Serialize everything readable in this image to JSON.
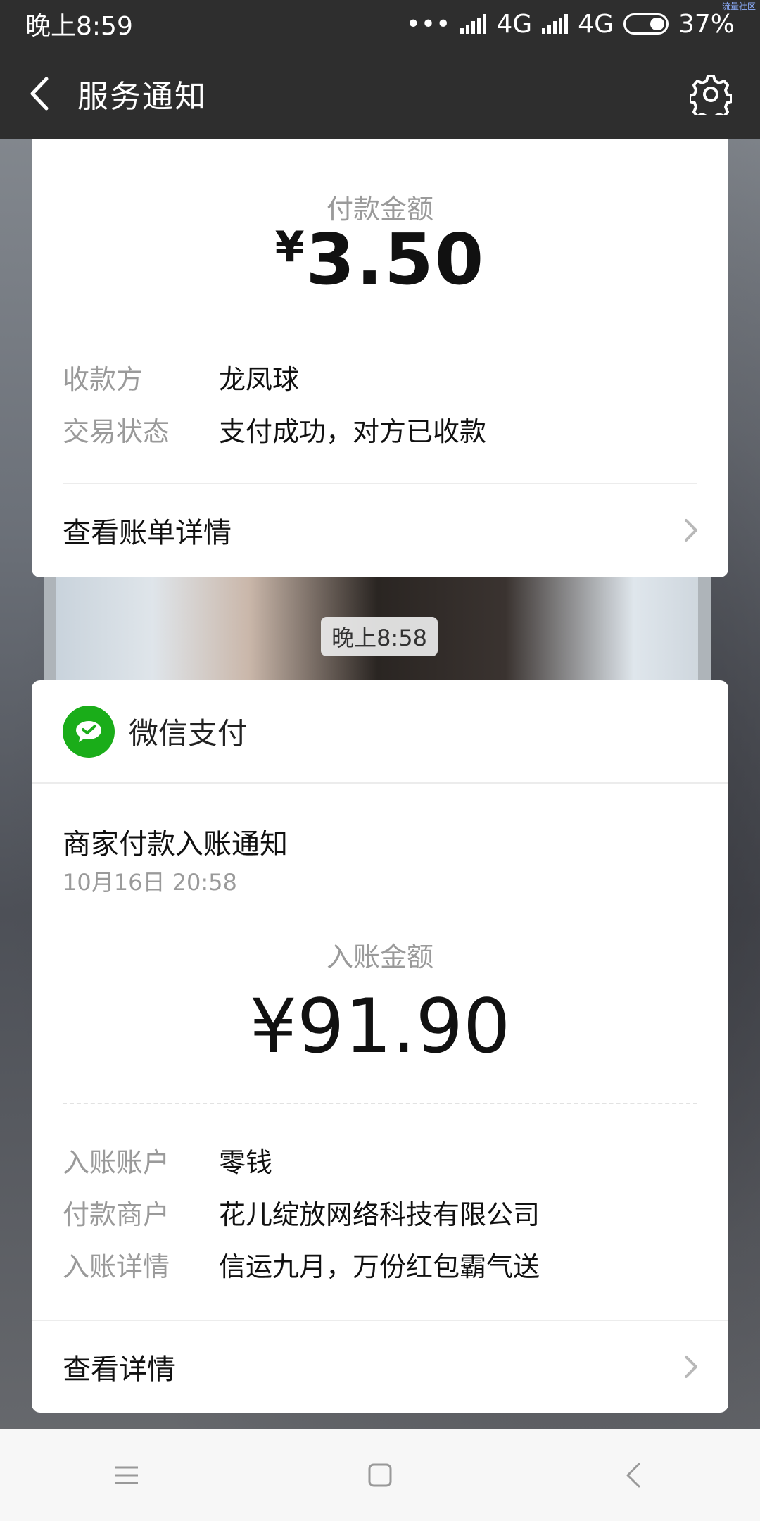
{
  "status": {
    "time": "晚上8:59",
    "net1": "4G",
    "net2": "4G",
    "battery": "37%",
    "tiny": "流量社区"
  },
  "nav": {
    "title": "服务通知"
  },
  "card1": {
    "amount_label": "付款金额",
    "currency": "¥",
    "amount": "3.50",
    "rows": [
      {
        "k": "收款方",
        "v": "龙凤球"
      },
      {
        "k": "交易状态",
        "v": "支付成功，对方已收款"
      }
    ],
    "link": "查看账单详情"
  },
  "time_pill": "晚上8:58",
  "card2": {
    "app_name": "微信支付",
    "title": "商家付款入账通知",
    "datetime": "10月16日  20:58",
    "amount_label": "入账金额",
    "amount": "¥91.90",
    "rows": [
      {
        "k": "入账账户",
        "v": "零钱"
      },
      {
        "k": "付款商户",
        "v": "花儿绽放网络科技有限公司"
      },
      {
        "k": "入账详情",
        "v": "信运九月，万份红包霸气送"
      }
    ],
    "link": "查看详情"
  },
  "icons": [
    "back-icon",
    "gear-icon",
    "chevron-right-icon",
    "wechat-pay-icon",
    "menu-icon",
    "home-icon",
    "back-nav-icon"
  ]
}
